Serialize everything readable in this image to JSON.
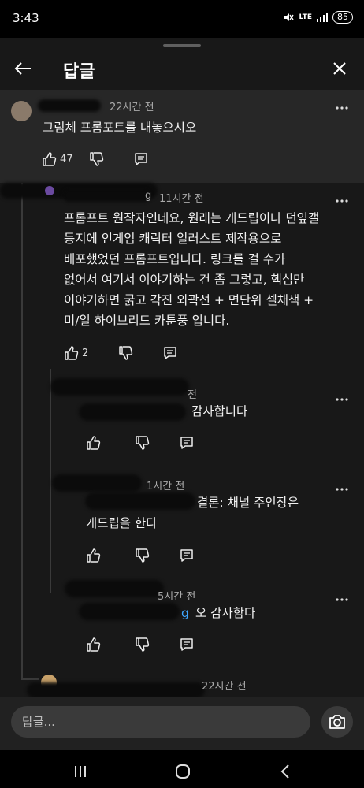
{
  "status_bar": {
    "time": "3:43",
    "network": "LTE",
    "battery": "85"
  },
  "header": {
    "title": "답글"
  },
  "comments": [
    {
      "time": "22시간 전",
      "text": "그림체 프롬포트를 내놓으시오",
      "likes": "47"
    },
    {
      "author_partial": "g",
      "time": "11시간 전",
      "text": "프롬프트 원작자인데요, 원래는 개드립이나 던잎갤\n등지에 인게임 캐릭터 일러스트 제작용으로\n배포했었던 프롬프트입니다. 링크를 걸 수가\n없어서 여기서 이야기하는 건 좀 그렇고, 핵심만\n이야기하면 굵고 각진 외곽선 + 면단위 셀채색 +\n미/일 하이브리드 카툰풍 입니다.",
      "likes": "2"
    },
    {
      "time_partial": "전",
      "text": "감사합니다"
    },
    {
      "time_partial": "1시간 전",
      "text_line1_partial": "결론: 채널 주인장은",
      "text_line2": "개드립을 한다"
    },
    {
      "time_partial": "5시간 전",
      "mention_partial": "g",
      "text": "오 감사함다"
    },
    {
      "time_partial": "22시간 전"
    }
  ],
  "reply_bar": {
    "placeholder": "답글..."
  },
  "icons": {
    "back": "arrow-left-icon",
    "close": "close-icon",
    "like": "thumbs-up-icon",
    "dislike": "thumbs-down-icon",
    "reply": "comment-icon",
    "more": "more-vertical-icon",
    "camera": "camera-icon"
  },
  "colors": {
    "mention": "#3ea6ff",
    "background": "#181818",
    "highlight": "#272727"
  }
}
